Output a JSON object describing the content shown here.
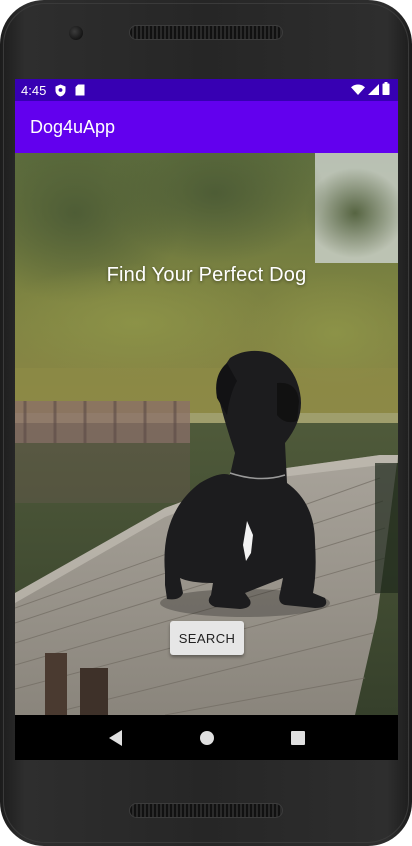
{
  "device": {
    "frame": "android-phone"
  },
  "status_bar": {
    "time": "4:45",
    "left_icons": [
      "shield-icon",
      "sd-card-icon"
    ],
    "right_icons": [
      "wifi-icon",
      "cell-signal-icon",
      "battery-icon"
    ]
  },
  "app_bar": {
    "title": "Dog4uApp",
    "color": "#6200ee",
    "status_color": "#3700b3"
  },
  "main": {
    "background": "photo: black great dane lying on a wooden pier by a lake with trees",
    "headline": "Find Your Perfect Dog",
    "search_button": "SEARCH"
  },
  "nav_bar": {
    "buttons": [
      "back-icon",
      "home-icon",
      "recents-icon"
    ]
  }
}
